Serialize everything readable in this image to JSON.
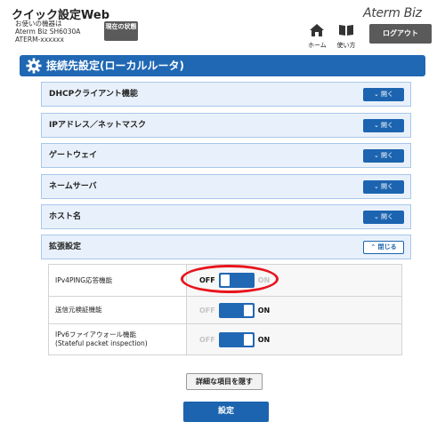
{
  "header": {
    "app_title": "クイック設定Web",
    "device_prefix": "お使いの機器は",
    "device_model": "Aterm Biz SH6030A",
    "device_name": "ATERM-xxxxxx",
    "status_button": "現在の状態",
    "brand": "Aterm Biz",
    "home_label": "ホーム",
    "home_icon": "home-icon",
    "howto_label": "使い方",
    "howto_icon": "book-icon",
    "logout_label": "ログアウト"
  },
  "page": {
    "title": "接続先設定(ローカルルータ)",
    "title_icon": "gear-icon",
    "accent_color": "#2068b4"
  },
  "sections": [
    {
      "label": "DHCPクライアント機能",
      "button": "開く",
      "button_icon": "chevron-down-icon"
    },
    {
      "label": "IPアドレス／ネットマスク",
      "button": "開く",
      "button_icon": "chevron-down-icon"
    },
    {
      "label": "ゲートウェイ",
      "button": "開く",
      "button_icon": "chevron-down-icon"
    },
    {
      "label": "ネームサーバ",
      "button": "開く",
      "button_icon": "chevron-down-icon"
    },
    {
      "label": "ホスト名",
      "button": "開く",
      "button_icon": "chevron-down-icon"
    },
    {
      "label": "拡張設定",
      "button": "閉じる",
      "button_icon": "chevron-up-icon"
    }
  ],
  "settings": [
    {
      "label_line1": "IPv4PING応答機能",
      "label_line2": "",
      "off_label": "OFF",
      "on_label": "ON",
      "state": "OFF"
    },
    {
      "label_line1": "送信元検証機能",
      "label_line2": "",
      "off_label": "OFF",
      "on_label": "ON",
      "state": "ON"
    },
    {
      "label_line1": "IPv6ファイアウォール機能",
      "label_line2": "(Stateful packet inspection)",
      "off_label": "OFF",
      "on_label": "ON",
      "state": "ON"
    }
  ],
  "buttons": {
    "hide_details": "詳細な項目を隠す",
    "submit": "設定"
  },
  "annotation": {
    "highlight_color": "#e8141c"
  }
}
